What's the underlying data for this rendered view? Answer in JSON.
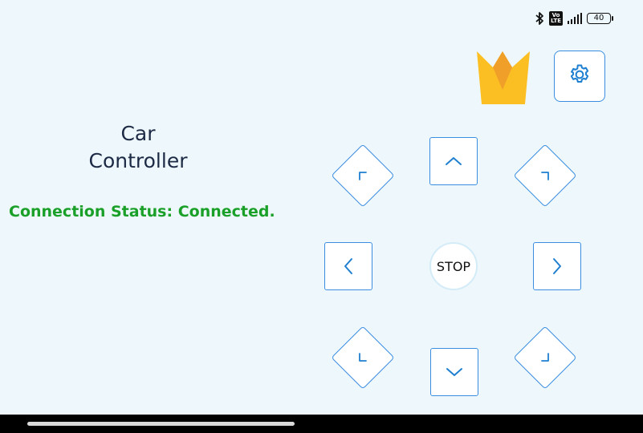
{
  "status_bar": {
    "volte_top": "Vo",
    "volte_bottom": "LTE",
    "battery_level": "40",
    "icons": [
      "bluetooth-icon",
      "volte-icon",
      "signal-icon",
      "battery-icon"
    ]
  },
  "app": {
    "title_line1": "Car",
    "title_line2": "Controller",
    "connection_status": "Connection Status: Connected."
  },
  "controls": {
    "stop_label": "STOP",
    "buttons": [
      "up-left",
      "up",
      "up-right",
      "left",
      "stop",
      "right",
      "down-left",
      "down",
      "down-right"
    ]
  },
  "colors": {
    "background": "#eef8fc",
    "button_border": "#3a8ee0",
    "arrow": "#1f7fd0",
    "connected": "#1aa029",
    "title": "#1d2a45",
    "crown_main": "#fbbf24",
    "crown_inner": "#f0a029"
  },
  "icons": {
    "crown": "crown-icon",
    "settings": "gear-icon"
  }
}
